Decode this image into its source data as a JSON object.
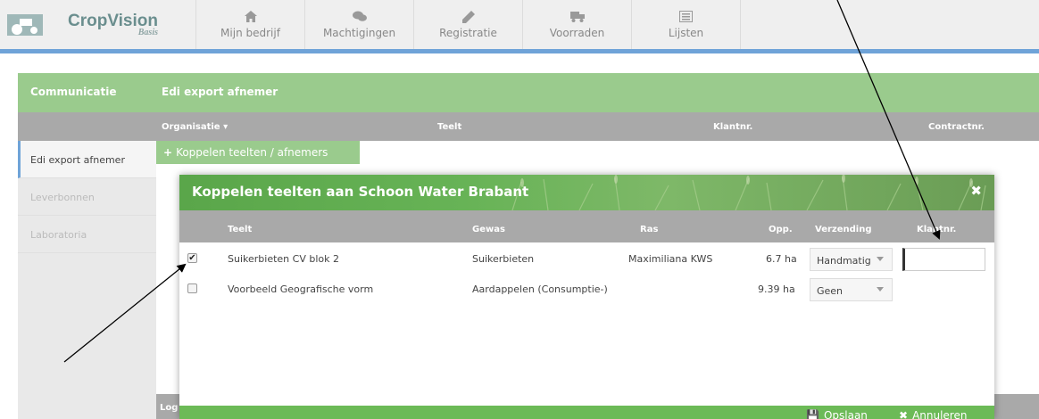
{
  "app": {
    "brand": "CropVision",
    "edition": "Basis"
  },
  "nav": [
    {
      "label": "Mijn bedrijf",
      "icon": "home-icon"
    },
    {
      "label": "Machtigingen",
      "icon": "chat-icon"
    },
    {
      "label": "Registratie",
      "icon": "pencil-icon"
    },
    {
      "label": "Voorraden",
      "icon": "truck-icon"
    },
    {
      "label": "Lijsten",
      "icon": "list-icon"
    }
  ],
  "header": {
    "section": "Communicatie",
    "page": "Edi export afnemer"
  },
  "columns": {
    "organisatie": "Organisatie",
    "teelt": "Teelt",
    "klantnr": "Klantnr.",
    "contractnr": "Contractnr."
  },
  "sidebar": {
    "items": [
      {
        "label": "Edi export afnemer",
        "active": true
      },
      {
        "label": "Leverbonnen",
        "active": false
      },
      {
        "label": "Laboratoria",
        "active": false
      }
    ]
  },
  "add_button": {
    "plus": "+",
    "label": "Koppelen teelten / afnemers"
  },
  "log_label": "Log",
  "modal": {
    "title": "Koppelen teelten aan Schoon Water Brabant",
    "close": "✖",
    "headers": {
      "teelt": "Teelt",
      "gewas": "Gewas",
      "ras": "Ras",
      "opp": "Opp.",
      "verzending": "Verzending",
      "klantnr": "Klantnr."
    },
    "rows": [
      {
        "checked": true,
        "check_mark": "✔",
        "teelt": "Suikerbieten CV blok 2",
        "gewas": "Suikerbieten",
        "ras": "Maximiliana KWS",
        "opp": "6.7 ha",
        "verzending": "Handmatig",
        "klantnr": ""
      },
      {
        "checked": false,
        "check_mark": "",
        "teelt": "Voorbeeld Geografische vorm",
        "gewas": "Aardappelen (Consumptie-)",
        "ras": "",
        "opp": "9.39 ha",
        "verzending": "Geen"
      }
    ],
    "footer": {
      "save": "Opslaan",
      "cancel": "Annuleren",
      "save_icon": "💾",
      "cancel_icon": "✖"
    }
  },
  "colors": {
    "green": "#9acb8d",
    "modal_green": "#6cba57",
    "grey_header": "#a9a9a9",
    "blue_accent": "#6fa3d8"
  }
}
